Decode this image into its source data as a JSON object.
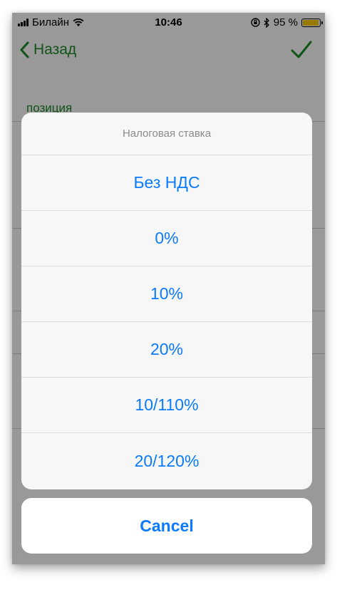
{
  "status_bar": {
    "carrier": "Билайн",
    "time": "10:46",
    "battery": "95 %",
    "battery_level": 0.95,
    "icons": [
      "signal-icon",
      "wifi-icon",
      "orientation-lock-icon",
      "bluetooth-icon",
      "battery-icon"
    ]
  },
  "nav": {
    "back_label": "Назад",
    "back_icon": "chevron-left-icon",
    "confirm_icon": "checkmark-icon"
  },
  "background": {
    "field_label": "позиция"
  },
  "colors": {
    "accent_green": "#1f8a2a",
    "ios_blue": "#0a7aff",
    "battery_yellow": "#ffcc00"
  },
  "action_sheet": {
    "title": "Налоговая ставка",
    "options": [
      {
        "label": "Без НДС"
      },
      {
        "label": "0%"
      },
      {
        "label": "10%"
      },
      {
        "label": "20%"
      },
      {
        "label": "10/110%"
      },
      {
        "label": "20/120%"
      }
    ],
    "cancel_label": "Cancel"
  }
}
